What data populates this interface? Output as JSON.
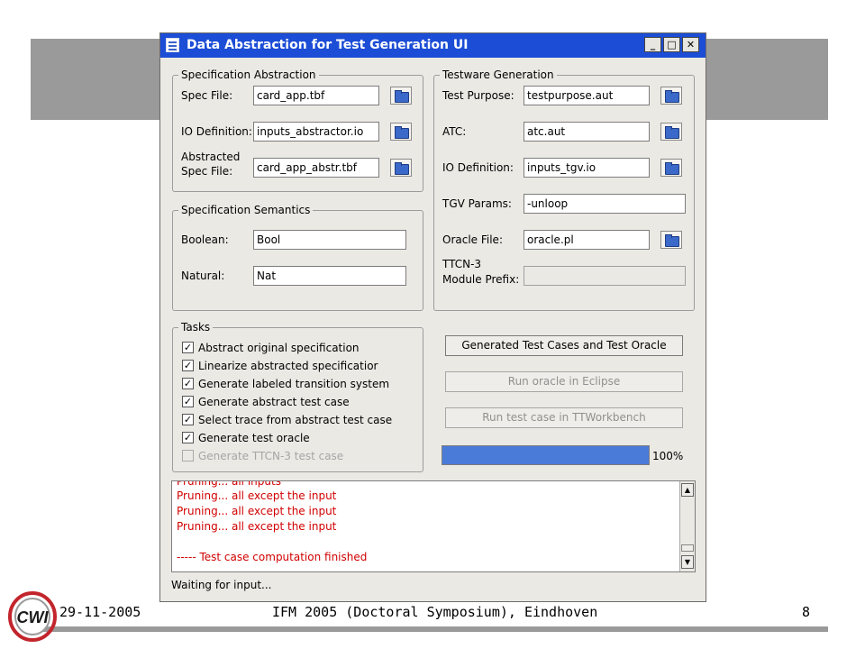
{
  "window": {
    "title": "Data Abstraction for Test Generation UI",
    "minimize": "_",
    "maximize": "□",
    "close": "✕"
  },
  "spec_abstraction": {
    "legend": "Specification Abstraction",
    "spec_file_label": "Spec File:",
    "spec_file": "card_app.tbf",
    "io_def_label": "IO Definition:",
    "io_def": "inputs_abstractor.io",
    "abstracted_label_1": "Abstracted",
    "abstracted_label_2": "Spec File:",
    "abstracted": "card_app_abstr.tbf"
  },
  "spec_semantics": {
    "legend": "Specification Semantics",
    "boolean_label": "Boolean:",
    "boolean": "Bool",
    "natural_label": "Natural:",
    "natural": "Nat"
  },
  "testware": {
    "legend": "Testware Generation",
    "purpose_label": "Test Purpose:",
    "purpose": "testpurpose.aut",
    "atc_label": "ATC:",
    "atc": "atc.aut",
    "io_def_label": "IO Definition:",
    "io_def": "inputs_tgv.io",
    "tgv_label": "TGV Params:",
    "tgv": "-unloop",
    "oracle_label": "Oracle File:",
    "oracle": "oracle.pl",
    "ttcn_label_1": "TTCN-3",
    "ttcn_label_2": "Module Prefix:",
    "ttcn": ""
  },
  "tasks": {
    "legend": "Tasks",
    "items": [
      {
        "label": "Abstract original specification",
        "checked": true,
        "enabled": true
      },
      {
        "label": "Linearize abstracted specificatior",
        "checked": true,
        "enabled": true
      },
      {
        "label": "Generate labeled transition system",
        "checked": true,
        "enabled": true
      },
      {
        "label": "Generate abstract test case",
        "checked": true,
        "enabled": true
      },
      {
        "label": "Select trace from abstract test case",
        "checked": true,
        "enabled": true
      },
      {
        "label": "Generate test oracle",
        "checked": true,
        "enabled": true
      },
      {
        "label": "Generate TTCN-3 test case",
        "checked": false,
        "enabled": false
      }
    ],
    "check_mark": "✓"
  },
  "buttons": {
    "generate": "Generated Test Cases and Test Oracle",
    "run_oracle": "Run oracle in Eclipse",
    "run_test": "Run test case in TTWorkbench"
  },
  "progress": {
    "value": 1.0,
    "label": "100%"
  },
  "log": {
    "lines": [
      "Pruning... all inputs",
      "Pruning... all except the input",
      "Pruning... all except the input",
      "Pruning... all except the input",
      "",
      "----- Test case computation finished"
    ],
    "scroll_up": "▲",
    "scroll_down": "▼"
  },
  "status": "Waiting for input...",
  "footer": {
    "date": "29-11-2005",
    "event": "IFM 2005 (Doctoral Symposium), Eindhoven",
    "page": "8",
    "logo_text": "CWI"
  },
  "colors": {
    "titlebar": "#1c4dd6",
    "progress": "#4b7bd8",
    "log_text": "#d10000",
    "band": "#9a9a9a"
  }
}
